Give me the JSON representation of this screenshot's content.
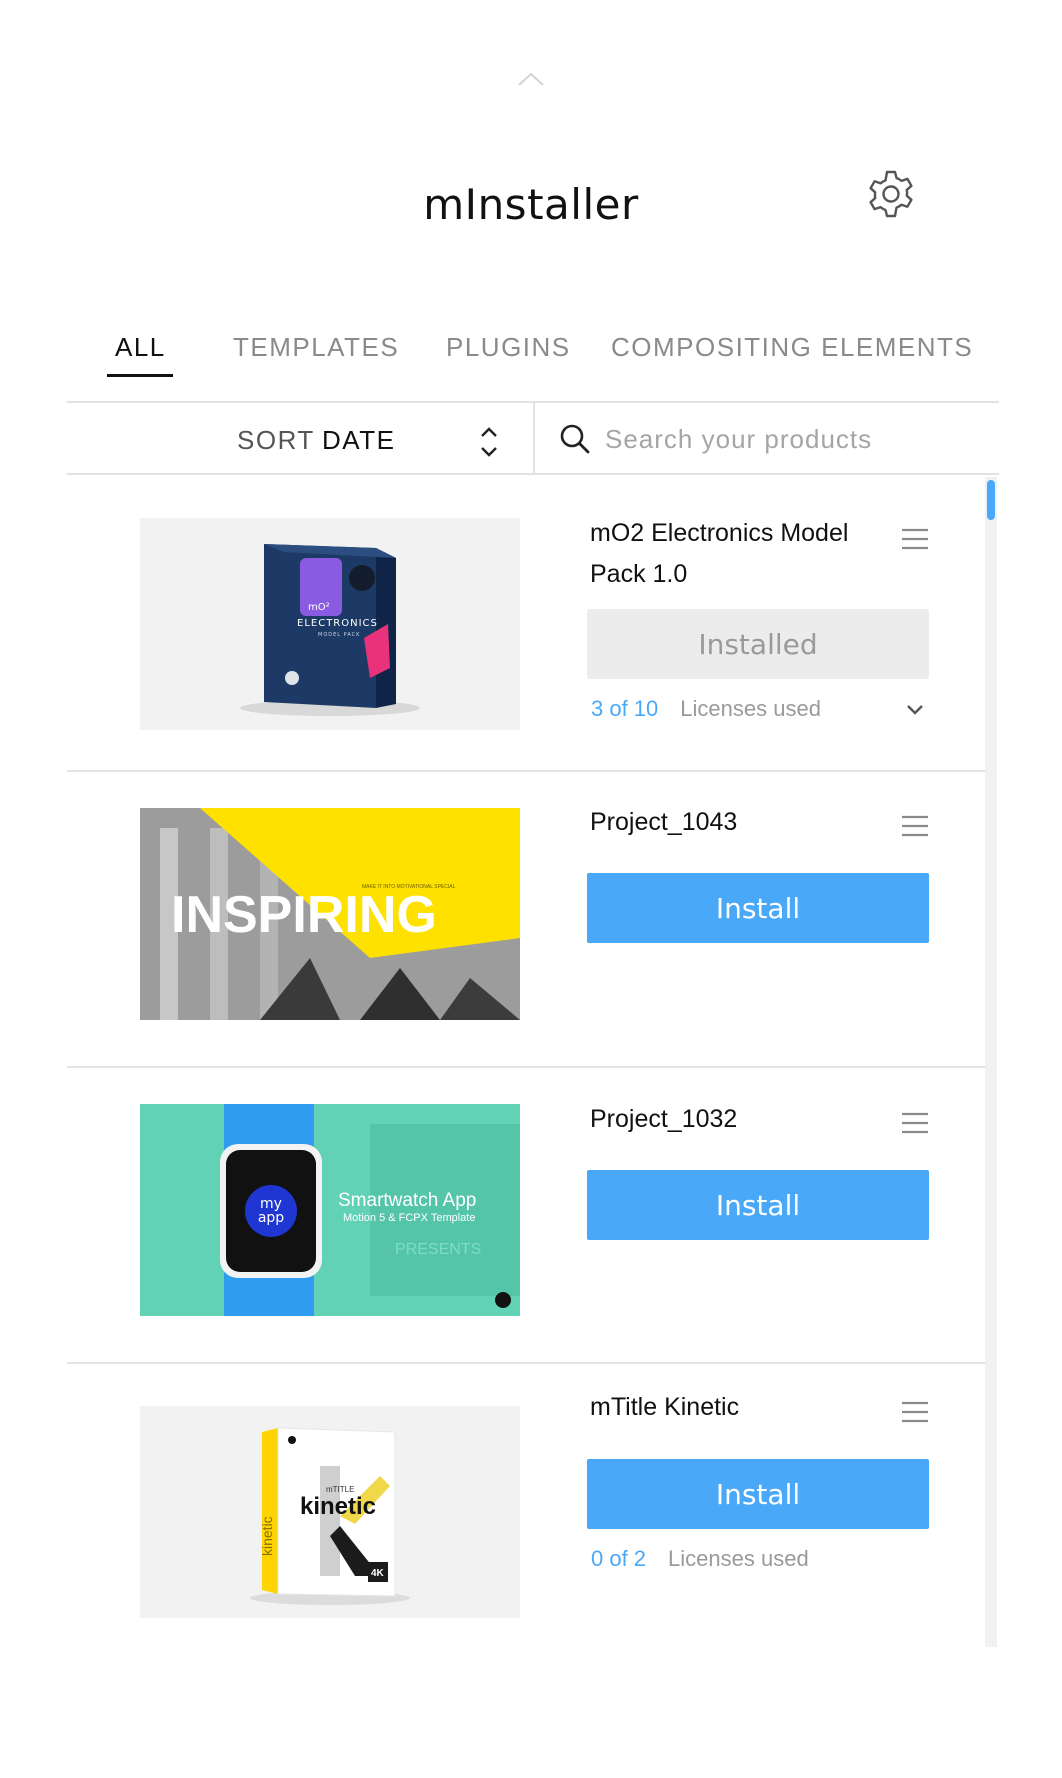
{
  "app": {
    "title": "mInstaller"
  },
  "icons": {
    "top_caret": "chevron-up-icon",
    "settings": "gear-icon",
    "sort": "sort-chevrons-icon",
    "search": "search-icon",
    "item_menu": "hamburger-menu-icon",
    "expand": "chevron-down-icon"
  },
  "tabs": [
    {
      "label": "ALL",
      "active": true
    },
    {
      "label": "TEMPLATES",
      "active": false
    },
    {
      "label": "PLUGINS",
      "active": false
    },
    {
      "label": "COMPOSITING ELEMENTS",
      "active": false
    }
  ],
  "toolbar": {
    "sort_label": "SORT",
    "sort_value": "DATE",
    "search_placeholder": "Search your products"
  },
  "colors": {
    "accent": "#4aa8f8",
    "installed_bg": "#ececec",
    "text_muted": "#9a9a9a"
  },
  "products": [
    {
      "title": "mO2 Electronics Model Pack 1.0",
      "button": "Installed",
      "state": "installed",
      "license_count": "3 of 10",
      "license_label": "Licenses used",
      "thumb": {
        "brand_line": "mO²",
        "name": "ELECTRONICS",
        "sub": "MODEL PACK"
      }
    },
    {
      "title": "Project_1043",
      "button": "Install",
      "state": "install",
      "thumb": {
        "headline": "INSPIRING",
        "tagline": "MAKE IT INTO MOTIVATIONAL SPECIAL"
      }
    },
    {
      "title": "Project_1032",
      "button": "Install",
      "state": "install",
      "thumb": {
        "watch_text_1": "my",
        "watch_text_2": "app",
        "headline": "Smartwatch App",
        "subline": "Motion 5 & FCPX Template",
        "bg_word": "PRESENTS"
      }
    },
    {
      "title": "mTitle Kinetic",
      "button": "Install",
      "state": "install",
      "license_count": "0 of 2",
      "license_label": "Licenses used",
      "thumb": {
        "spine": "kinetic",
        "small": "mTITLE",
        "name": "kinetic",
        "badge": "4K"
      }
    }
  ]
}
